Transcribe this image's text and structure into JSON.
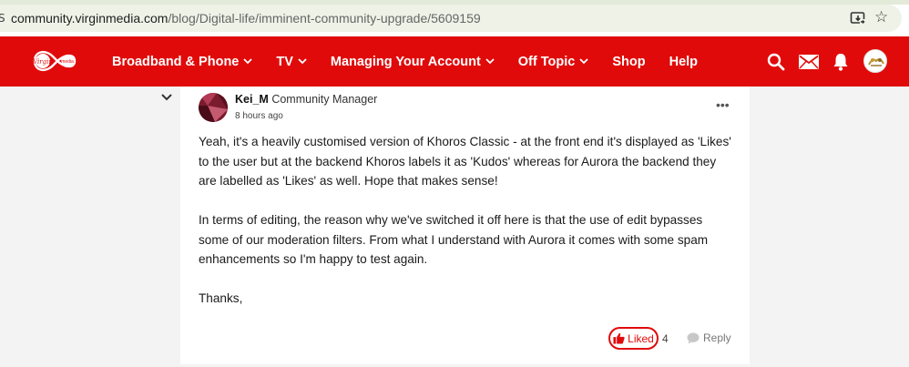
{
  "browser": {
    "url_host": "community.virginmedia.com",
    "url_path": "/blog/Digital-life/imminent-community-upgrade/5609159"
  },
  "nav": {
    "menu": [
      {
        "label": "Broadband & Phone",
        "dropdown": true
      },
      {
        "label": "TV",
        "dropdown": true
      },
      {
        "label": "Managing Your Account",
        "dropdown": true
      },
      {
        "label": "Off Topic",
        "dropdown": true
      },
      {
        "label": "Shop",
        "dropdown": false
      },
      {
        "label": "Help",
        "dropdown": false
      }
    ],
    "icons": [
      "search-icon",
      "mail-icon",
      "bell-icon",
      "user-avatar"
    ],
    "brand_color": "#e10a0a"
  },
  "post": {
    "author": "Kei_M",
    "role": "Community Manager",
    "time": "8 hours ago",
    "paragraphs": [
      "Yeah, it's a heavily customised version of Khoros Classic - at the front end it's displayed as 'Likes' to the user but at the backend Khoros labels it as 'Kudos' whereas for Aurora the backend they are labelled as 'Likes' as well. Hope that makes sense!",
      "In terms of editing, the reason why we've switched it off here is that the use of edit bypasses some of our moderation filters. From what I understand with Aurora it comes with some spam enhancements so I'm happy to test again.",
      "Thanks,"
    ],
    "liked_label": "Liked",
    "like_count": "4",
    "reply_label": "Reply"
  }
}
